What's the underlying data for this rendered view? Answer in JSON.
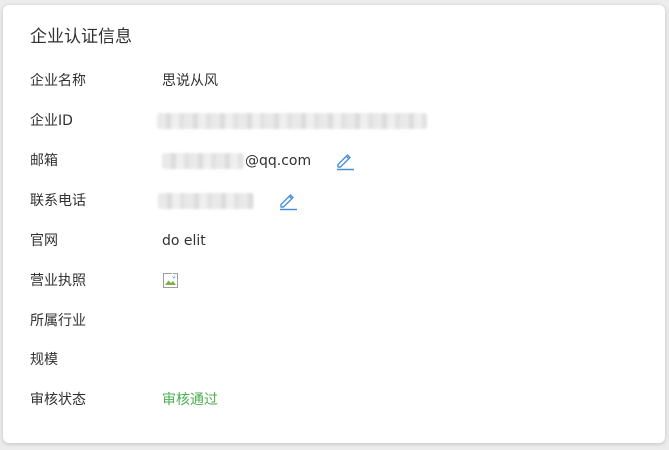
{
  "card": {
    "title": "企业认证信息"
  },
  "fields": [
    {
      "label": "企业名称",
      "value": "思说从风"
    },
    {
      "label": "企业ID",
      "value": ""
    },
    {
      "label": "邮箱",
      "value": "@qq.com"
    },
    {
      "label": "联系电话",
      "value": ""
    },
    {
      "label": "官网",
      "value": "do elit"
    },
    {
      "label": "营业执照",
      "value": ""
    },
    {
      "label": "所属行业",
      "value": ""
    },
    {
      "label": "规模",
      "value": ""
    },
    {
      "label": "审核状态",
      "value": "审核通过"
    }
  ],
  "colors": {
    "status_green": "#4caf50",
    "edit_icon_blue": "#4a90d9",
    "text": "#303133"
  },
  "icons": {
    "edit": "pencil-edit-icon",
    "license": "broken-image-icon"
  }
}
